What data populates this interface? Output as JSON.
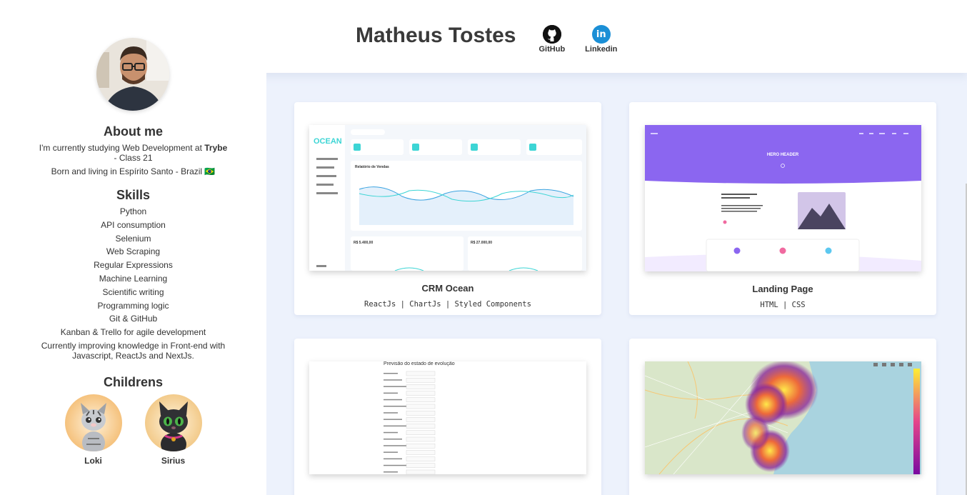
{
  "header": {
    "title": "Matheus Tostes",
    "links": [
      {
        "label": "GitHub",
        "icon": "github-icon"
      },
      {
        "label": "Linkedin",
        "icon": "linkedin-icon"
      }
    ]
  },
  "sidebar": {
    "about_heading": "About me",
    "about_line1_pre": "I'm currently studying Web Development at ",
    "about_line1_bold": "Trybe",
    "about_line1_post": " - Class 21",
    "about_line2": "Born and living in Espírito Santo - Brazil 🇧🇷",
    "skills_heading": "Skills",
    "skills": [
      "Python",
      "API consumption",
      "Selenium",
      "Web Scraping",
      "Regular Expressions",
      "Machine Learning",
      "Scientific writing",
      "Programming logic",
      "Git & GitHub",
      "Kanban & Trello for agile development",
      "Currently improving knowledge in Front-end with Javascript, ReactJs and NextJs."
    ],
    "children_heading": "Childrens",
    "children": [
      "Loki",
      "Sirius"
    ]
  },
  "projects": [
    {
      "title": "CRM Ocean",
      "tech": "ReactJs | ChartJs | Styled Components"
    },
    {
      "title": "Landing Page",
      "tech": "HTML | CSS"
    },
    {
      "title": "",
      "tech": "",
      "thumb_heading": "Previsão do estado de evolução"
    },
    {
      "title": "",
      "tech": ""
    }
  ],
  "thumbs": {
    "crm_logo": "OCEAN",
    "crm_chart_title": "Relatório de Vendas",
    "crm_value1": "R$ 5.400,00",
    "crm_value2": "R$ 27.000,00",
    "landing_title": "HERO HEADER"
  },
  "colors": {
    "main_bg": "#edf2fc",
    "landing_purple": "#8b66f0",
    "crm_accent": "#3dd5d5",
    "linkedin_blue": "#1b8fd6"
  }
}
